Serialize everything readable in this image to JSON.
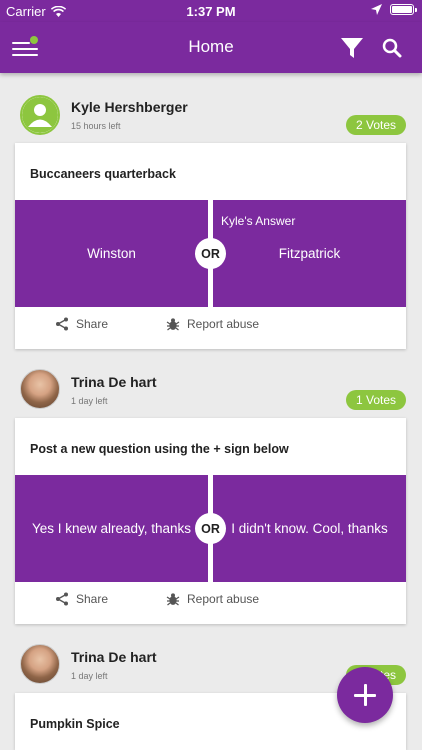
{
  "status_bar": {
    "carrier": "Carrier",
    "time": "1:37 PM"
  },
  "header": {
    "title": "Home"
  },
  "posts": [
    {
      "author": "Kyle Hershberger",
      "time_left": "15 hours left",
      "votes": "2 Votes",
      "question": "Buccaneers quarterback",
      "option_a": "Winston",
      "option_b": "Fitzpatrick",
      "answer_tag": "Kyle's Answer",
      "or_label": "OR",
      "share_label": "Share",
      "report_label": "Report abuse"
    },
    {
      "author": "Trina De hart",
      "time_left": "1 day left",
      "votes": "1 Votes",
      "question": "Post a new question using the + sign below",
      "option_a": "Yes I knew already, thanks",
      "option_b": "I didn't know. Cool, thanks",
      "or_label": "OR",
      "share_label": "Share",
      "report_label": "Report abuse"
    },
    {
      "author": "Trina De hart",
      "time_left": "1 day left",
      "votes": "1 Votes",
      "question": "Pumpkin Spice"
    }
  ],
  "colors": {
    "brand_purple": "#7b2a9e",
    "accent_green": "#8dc63f",
    "background": "#ebebeb"
  },
  "icons": [
    "wifi-icon",
    "location-arrow-icon",
    "battery-icon",
    "menu-icon",
    "filter-icon",
    "search-icon",
    "default-avatar-icon",
    "share-icon",
    "bug-icon",
    "plus-icon"
  ]
}
